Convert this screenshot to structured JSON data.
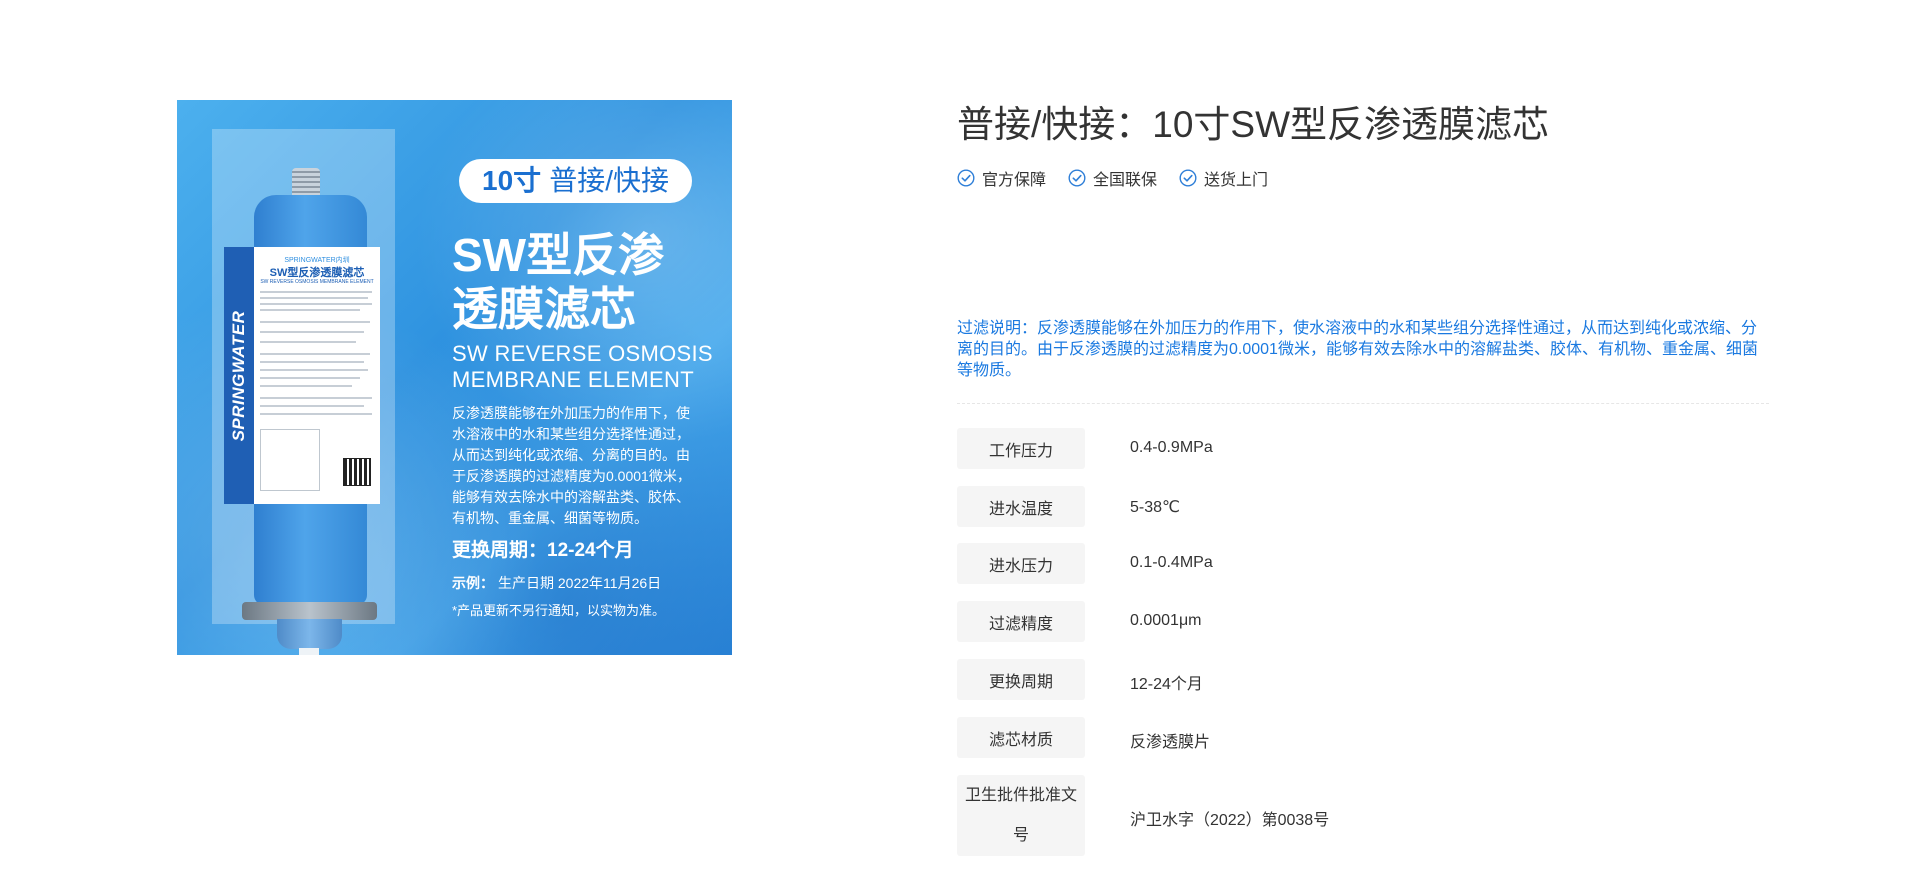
{
  "product_image": {
    "badge_bold": "10寸",
    "badge_text": "普接/快接",
    "title_lines": [
      "SW型反渗",
      "透膜滤芯"
    ],
    "english_lines": [
      "SW REVERSE OSMOSIS",
      "MEMBRANE ELEMENT"
    ],
    "desc_lines": [
      "反渗透膜能够在外加压力的作用下，使",
      "水溶液中的水和某些组分选择性通过，",
      "从而达到纯化或浓缩、分离的目的。由",
      "于反渗透膜的过滤精度为0.0001微米，",
      "能够有效去除水中的溶解盐类、胶体、",
      "有机物、重金属、细菌等物质。"
    ],
    "cycle": "更换周期：12-24个月",
    "example_label": "示例：",
    "example_text": "生产日期 2022年11月26日",
    "note": "*产品更新不另行通知，以实物为准。",
    "label_brand": "SPRINGWATER内圳",
    "label_title": "SW型反渗透膜滤芯",
    "label_sub": "SW REVERSE OSMOSIS MEMBRANE ELEMENT",
    "label_stripe": "SPRINGWATER"
  },
  "product": {
    "title": "普接/快接：10寸SW型反渗透膜滤芯",
    "badges": [
      "官方保障",
      "全国联保",
      "送货上门"
    ],
    "description": "过滤说明：反渗透膜能够在外加压力的作用下，使水溶液中的水和某些组分选择性通过，从而达到纯化或浓缩、分离的目的。由于反渗透膜的过滤精度为0.0001微米，能够有效去除水中的溶解盐类、胶体、有机物、重金属、细菌等物质。"
  },
  "specs": [
    {
      "label": "工作压力",
      "value": "0.4-0.9MPa"
    },
    {
      "label": "进水温度",
      "value": "5-38℃"
    },
    {
      "label": "进水压力",
      "value": "0.1-0.4MPa"
    },
    {
      "label": "过滤精度",
      "value": "0.0001μm"
    },
    {
      "label": "更换周期",
      "value": "12-24个月"
    },
    {
      "label": "滤芯材质",
      "value": "反渗透膜片"
    },
    {
      "label": "卫生批件批准文号",
      "value": "沪卫水字（2022）第0038号"
    }
  ],
  "colors": {
    "accent_blue": "#1a79e0",
    "check_icon": "#2f7fd8",
    "spec_label_bg": "#f5f5f5",
    "text": "#333333"
  }
}
